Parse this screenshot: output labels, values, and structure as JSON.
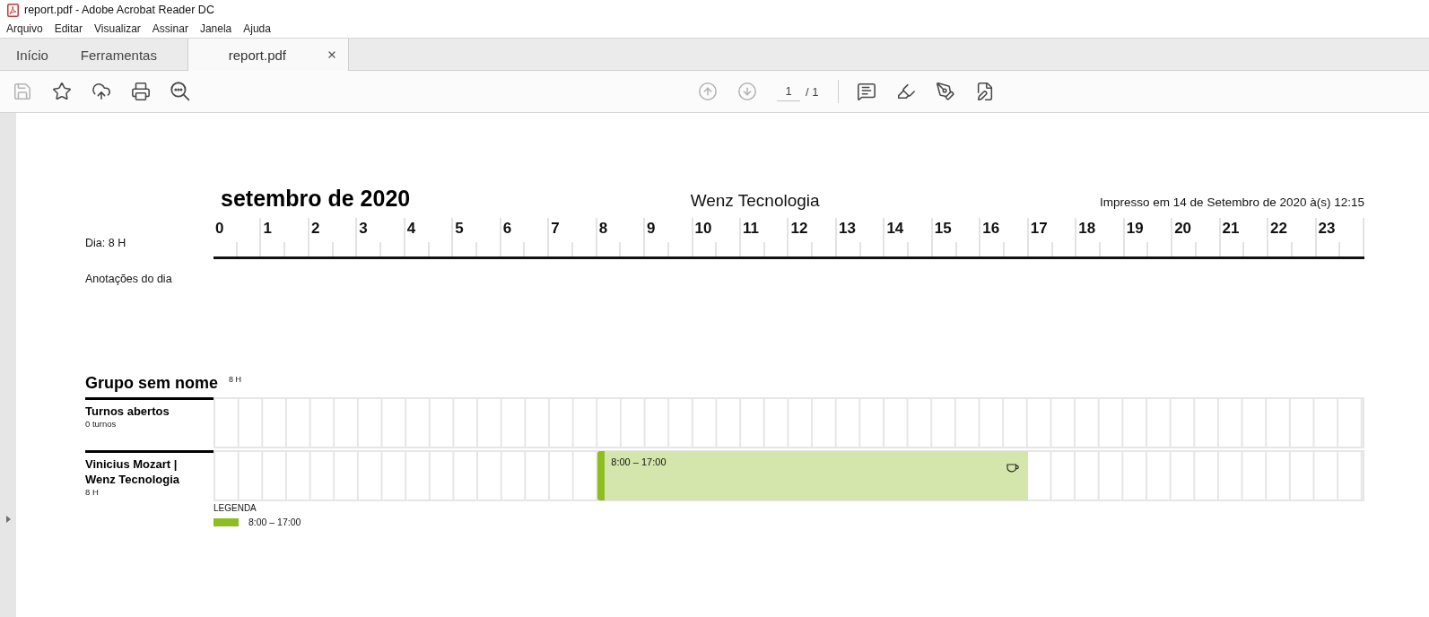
{
  "window": {
    "title": "report.pdf - Adobe Acrobat Reader DC"
  },
  "menu": [
    "Arquivo",
    "Editar",
    "Visualizar",
    "Assinar",
    "Janela",
    "Ajuda"
  ],
  "tabs": [
    {
      "label": "Início",
      "selected": false,
      "closable": false
    },
    {
      "label": "Ferramentas",
      "selected": false,
      "closable": false
    },
    {
      "label": "report.pdf",
      "selected": true,
      "closable": true
    }
  ],
  "toolbar": {
    "tools": [
      {
        "kind": "save",
        "disabled": true
      },
      {
        "kind": "bookmark",
        "disabled": false
      },
      {
        "kind": "upload",
        "disabled": false
      },
      {
        "kind": "print",
        "disabled": false
      },
      {
        "kind": "zoom",
        "disabled": false
      }
    ],
    "navigation": [
      {
        "kind": "previous",
        "disabled": true
      },
      {
        "kind": "next",
        "disabled": true
      }
    ],
    "page": {
      "current": "1",
      "total": "/ 1"
    },
    "annotate": [
      {
        "kind": "comment"
      },
      {
        "kind": "highlight"
      },
      {
        "kind": "sign"
      },
      {
        "kind": "fill-sign"
      }
    ]
  },
  "report": {
    "month": "setembro de 2020",
    "company": "Wenz Tecnologia",
    "printed": "Impresso em 14 de Setembro de 2020 à(s) 12:15",
    "day_total": "Dia: 8 H",
    "notes_label": "Anotações do dia",
    "hours": [
      "0",
      "1",
      "2",
      "3",
      "4",
      "5",
      "6",
      "7",
      "8",
      "9",
      "10",
      "11",
      "12",
      "13",
      "14",
      "15",
      "16",
      "17",
      "18",
      "19",
      "20",
      "21",
      "22",
      "23"
    ]
  },
  "group": {
    "name": "Grupo sem nome",
    "total": "8 H",
    "rows": [
      {
        "name": "Turnos abertos",
        "detail": "0 turnos"
      },
      {
        "name": "Vinicius Mozart | Wenz Tecnologia",
        "detail": "8 H",
        "shifts": [
          {
            "time": "8:00 – 17:00",
            "color": "#8dbd21",
            "break": true
          }
        ]
      }
    ]
  },
  "legend": {
    "title": "LEGENDA",
    "items": [
      {
        "label": "8:00 – 17:00",
        "color": "#8dbd21"
      }
    ]
  }
}
